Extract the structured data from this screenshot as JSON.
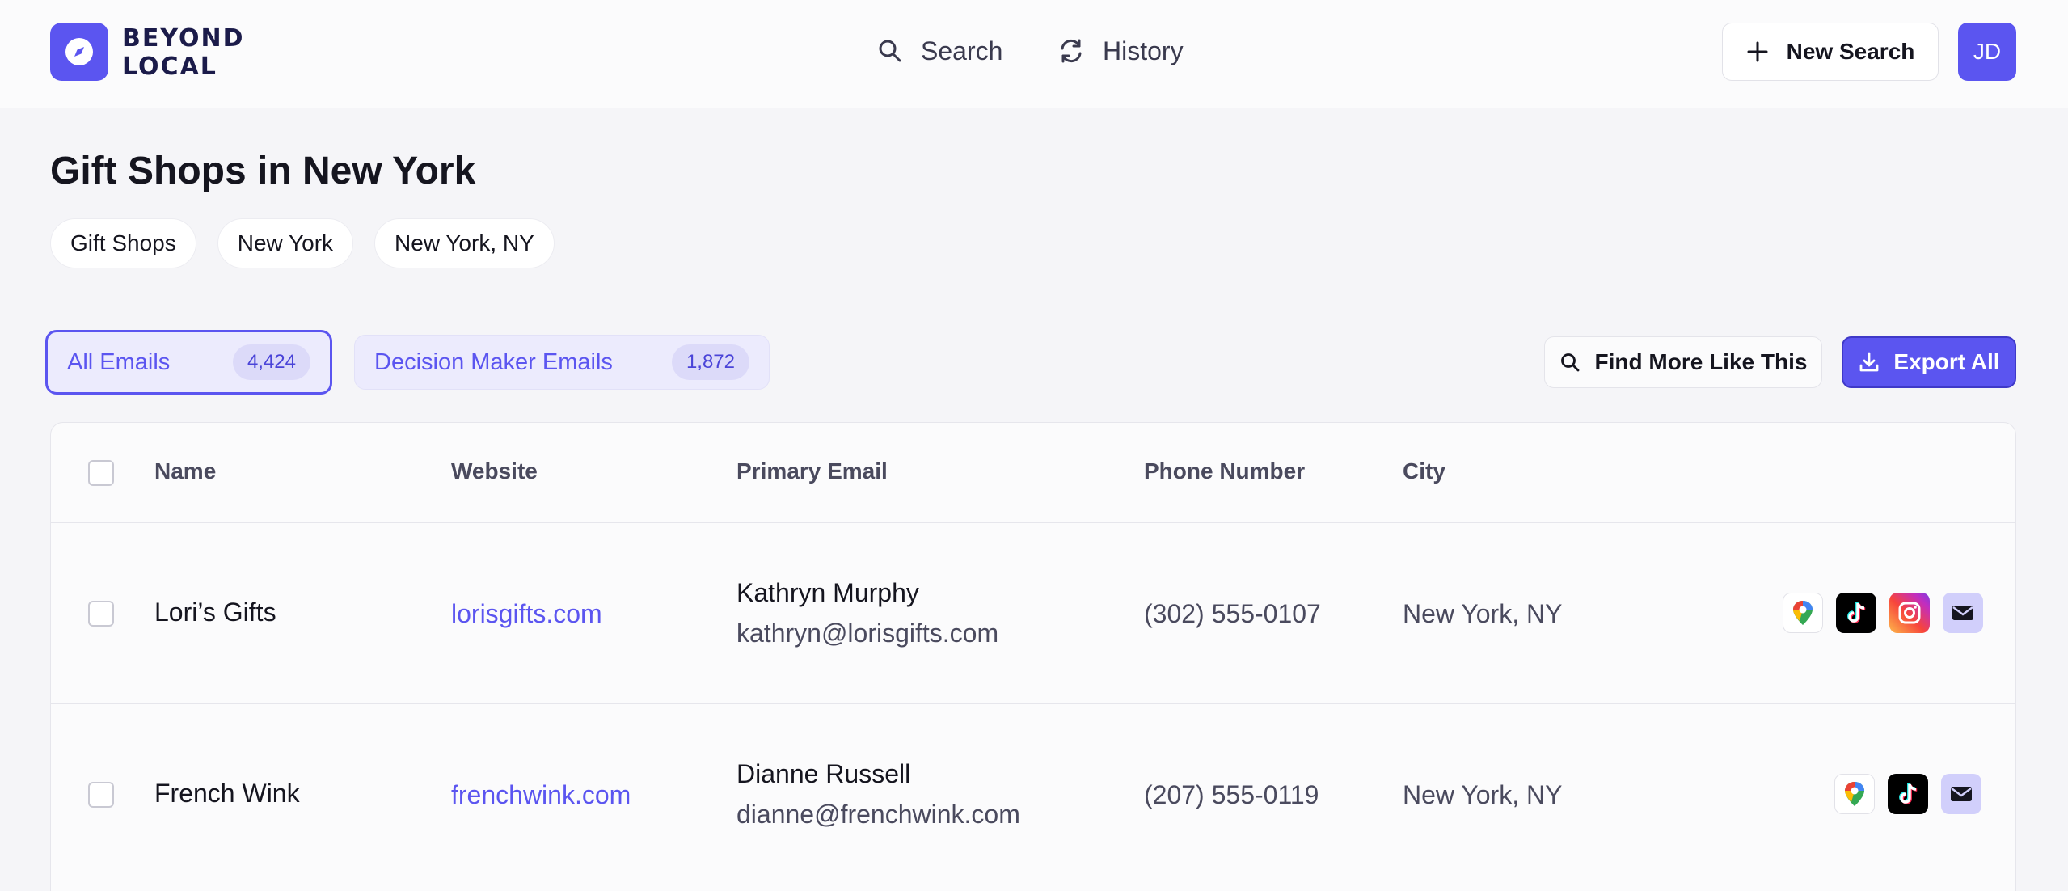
{
  "brand": {
    "line1": "BEYOND",
    "line2": "LOCAL",
    "accent": "#5b55f0"
  },
  "nav": {
    "search": {
      "label": "Search",
      "icon": "search-icon"
    },
    "history": {
      "label": "History",
      "icon": "history-icon"
    }
  },
  "header_actions": {
    "new_search_label": "New Search",
    "avatar_initials": "JD"
  },
  "page": {
    "title": "Gift Shops in New York",
    "chips": [
      "Gift Shops",
      "New York",
      "New York, NY"
    ]
  },
  "tabs": [
    {
      "label": "All Emails",
      "count": "4,424",
      "active": true
    },
    {
      "label": "Decision Maker Emails",
      "count": "1,872",
      "active": false
    }
  ],
  "actions": {
    "find_more_label": "Find More Like This",
    "export_label": "Export All"
  },
  "table": {
    "columns": [
      "Name",
      "Website",
      "Primary Email",
      "Phone Number",
      "City"
    ],
    "rows": [
      {
        "name": "Lori’s Gifts",
        "website": "lorisgifts.com",
        "contact_name": "Kathryn Murphy",
        "email": "kathryn@lorisgifts.com",
        "phone": "(302) 555-0107",
        "city": "New York, NY",
        "icons": [
          "google-maps-icon",
          "tiktok-icon",
          "instagram-icon",
          "mail-icon"
        ]
      },
      {
        "name": "French Wink",
        "website": "frenchwink.com",
        "contact_name": "Dianne Russell",
        "email": "dianne@frenchwink.com",
        "phone": "(207) 555-0119",
        "city": "New York, NY",
        "icons": [
          "google-maps-icon",
          "tiktok-icon",
          "mail-icon"
        ]
      }
    ]
  }
}
